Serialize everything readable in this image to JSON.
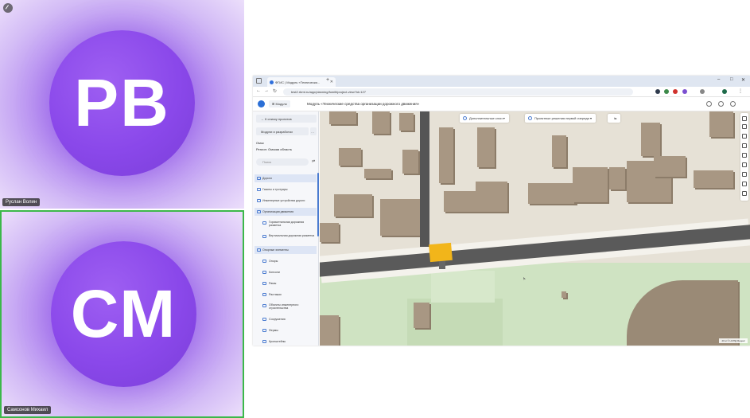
{
  "tiles": {
    "top": {
      "initials": "РВ",
      "name": "Руслан Волин"
    },
    "bottom": {
      "initials": "СМ",
      "name": "Самсонов Михаил"
    }
  },
  "browser": {
    "tab_title": "ФГИС | Модуль «Технически...",
    "url": "test2.rbmt.ru/app/planning/fomilt/project-view?id=127",
    "modules_label": "⊞ Модули",
    "app_title": "Модуль «Технические средства организации дорожного движения»"
  },
  "sidebar": {
    "back_button": "← К списку проектов",
    "modules_button": "Модули и разработки",
    "city": "Омск",
    "region_label": "Регион:",
    "region_value": "Омская область",
    "search_placeholder": "Поиск",
    "items": [
      {
        "label": "Дороги",
        "sub": false,
        "hl": true,
        "tall": false
      },
      {
        "label": "Газоны и тротуары",
        "sub": false,
        "hl": false,
        "tall": false
      },
      {
        "label": "Инженерные устройства дороги",
        "sub": false,
        "hl": false,
        "tall": false
      },
      {
        "label": "Организация движения",
        "sub": false,
        "hl": true,
        "tall": false
      },
      {
        "label": "Горизонтальная дорожная разметка",
        "sub": true,
        "hl": false,
        "tall": true
      },
      {
        "label": "Вертикальная дорожная разметка",
        "sub": true,
        "hl": false,
        "tall": true
      },
      {
        "label": "Опорные элементы",
        "sub": false,
        "hl": true,
        "tall": false
      },
      {
        "label": "Опоры",
        "sub": true,
        "hl": false,
        "tall": false
      },
      {
        "label": "Консоли",
        "sub": true,
        "hl": false,
        "tall": false
      },
      {
        "label": "Рамы",
        "sub": true,
        "hl": false,
        "tall": false
      },
      {
        "label": "Растяжки",
        "sub": true,
        "hl": false,
        "tall": false
      },
      {
        "label": "Объекты инженерного строительства",
        "sub": true,
        "hl": false,
        "tall": true
      },
      {
        "label": "Сооружения",
        "sub": true,
        "hl": false,
        "tall": false
      },
      {
        "label": "Фермы",
        "sub": true,
        "hl": false,
        "tall": false
      },
      {
        "label": "Кронштейны",
        "sub": true,
        "hl": false,
        "tall": false
      },
      {
        "label": "Дорожные знаки",
        "sub": false,
        "hl": true,
        "tall": false
      }
    ]
  },
  "map": {
    "pill1": "Дополнительные слои ▾",
    "pill2": "Проектные решения первой очереди ▾",
    "scale": "20 м   © НСПД  Яндекс"
  },
  "colors": {
    "accent": "#2b6fd6",
    "avatar": "#8a48ea",
    "active_border": "#3cb84a",
    "road_yellow": "#f2b51a"
  }
}
